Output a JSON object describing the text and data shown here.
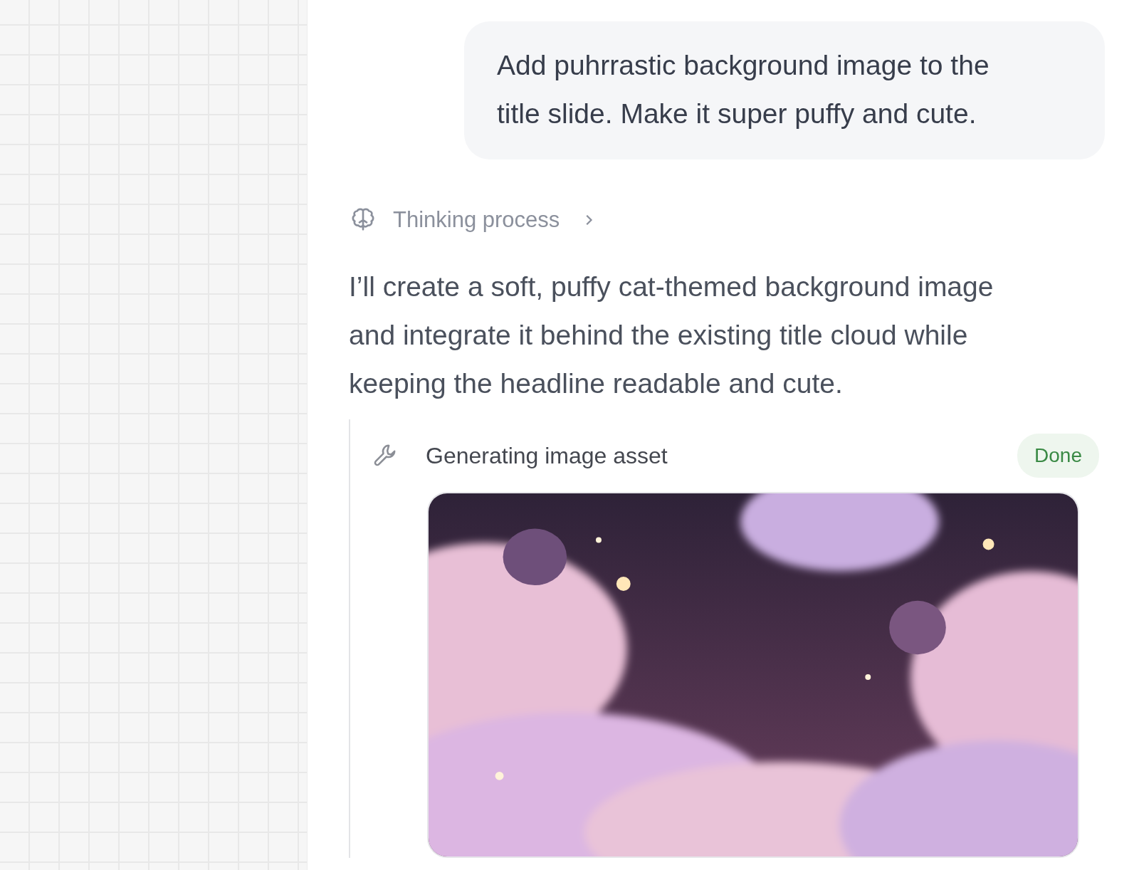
{
  "user_message": "Add puhrrastic background image to the title slide. Make it super puffy and cute.",
  "thinking": {
    "label": "Thinking process",
    "expanded": false
  },
  "assistant_message": "I’ll create a soft, puffy cat-themed background image and integrate it behind the existing title cloud while keeping the headline readable and cute.",
  "tool_call": {
    "label": "Generating image asset",
    "status": "Done"
  }
}
